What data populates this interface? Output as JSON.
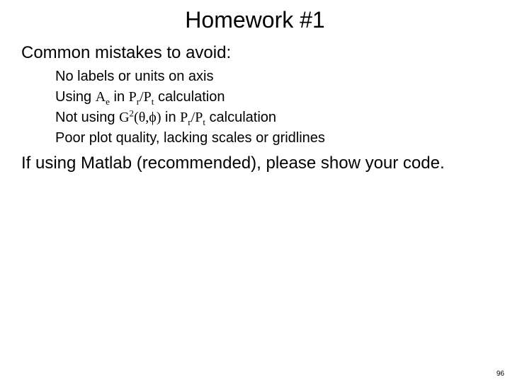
{
  "title": "Homework #1",
  "subhead": "Common mistakes to avoid:",
  "items": {
    "a": "No labels or units on axis",
    "b": {
      "pre": "Using ",
      "sym_A": "A",
      "sub_e": "e",
      "mid": " in ",
      "sym_P1": "P",
      "sub_r": "r",
      "slash": "/",
      "sym_P2": "P",
      "sub_t": "t",
      "post": " calculation"
    },
    "c": {
      "pre": "Not using ",
      "sym_G": "G",
      "sup_2": "2",
      "open": "(",
      "theta": "θ",
      "comma": ",",
      "phi": "ϕ",
      "close": ")",
      "mid": " in ",
      "sym_P1": "P",
      "sub_r": "r",
      "slash": "/",
      "sym_P2": "P",
      "sub_t": "t",
      "post": " calculation"
    },
    "d": "Poor plot quality, lacking scales or gridlines"
  },
  "closing": "If using Matlab (recommended), please show your code.",
  "page_number": "96"
}
